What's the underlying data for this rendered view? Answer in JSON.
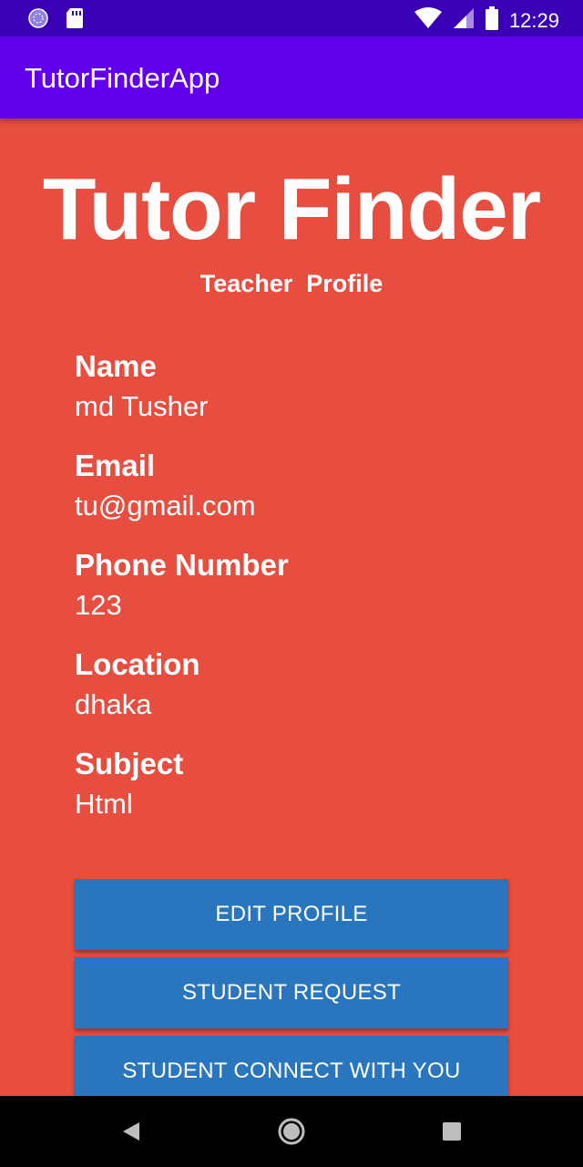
{
  "status_bar": {
    "time": "12:29",
    "icons": [
      "sync-icon",
      "sd-card-icon",
      "wifi-icon",
      "cell-signal-icon",
      "battery-icon"
    ]
  },
  "app_bar": {
    "title": "TutorFinderApp",
    "color": "#6200ee"
  },
  "header": {
    "title": "Tutor Finder",
    "subtitle": "Teacher  Profile"
  },
  "profile": {
    "fields": [
      {
        "label": "Name",
        "value": "md Tusher"
      },
      {
        "label": "Email",
        "value": "tu@gmail.com"
      },
      {
        "label": "Phone Number",
        "value": "123"
      },
      {
        "label": "Location",
        "value": "dhaka"
      },
      {
        "label": "Subject",
        "value": "Html"
      }
    ]
  },
  "buttons": {
    "edit_profile": "EDIT PROFILE",
    "student_request": "STUDENT REQUEST",
    "student_connect": "STUDENT CONNECT WITH YOU"
  },
  "nav_bar": {
    "icons": [
      "back-icon",
      "home-icon",
      "recents-icon"
    ]
  },
  "colors": {
    "background": "#e84e3f",
    "button": "#2976bf",
    "status_bar": "#3a00b5"
  }
}
